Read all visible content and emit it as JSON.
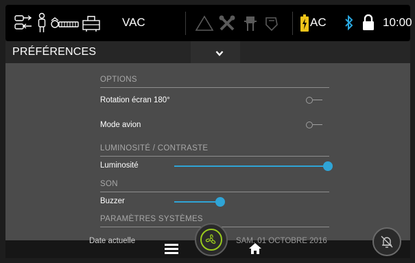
{
  "status": {
    "mode_label": "VAC",
    "power_label": "AC",
    "time": "10:00",
    "battery_color": "#f0c419",
    "bluetooth_color": "#2aa8e0"
  },
  "header": {
    "title": "PRÉFÉRENCES"
  },
  "sections": {
    "options": "OPTIONS",
    "luminosite": "LUMINOSITÉ / CONTRASTE",
    "son": "SON",
    "parametres": "PARAMÈTRES SYSTÈMES"
  },
  "rows": {
    "rotation": {
      "label": "Rotation écran 180°",
      "enabled": false
    },
    "avion": {
      "label": "Mode avion",
      "enabled": false
    },
    "luminosite": {
      "label": "Luminosité",
      "level": 1.0
    },
    "buzzer": {
      "label": "Buzzer",
      "level": 0.3
    },
    "date": {
      "label": "Date actuelle",
      "value": "SAM. 01 OCTOBRE 2016"
    }
  },
  "colors": {
    "accent": "#2fa4d6",
    "fan_ring": "#9acb1d"
  },
  "icons": {
    "status_left": [
      "airflow-icon",
      "patient-icon",
      "breathing-circuit-icon",
      "humidifier-icon"
    ],
    "status_center": [
      "warning-icon",
      "tools-icon",
      "connector-icon",
      "mask-icon"
    ],
    "status_right": [
      "battery-charging-icon",
      "bluetooth-icon",
      "lock-icon"
    ],
    "bottom": [
      "menu-icon",
      "fan-icon",
      "home-icon",
      "alarm-mute-icon"
    ]
  }
}
